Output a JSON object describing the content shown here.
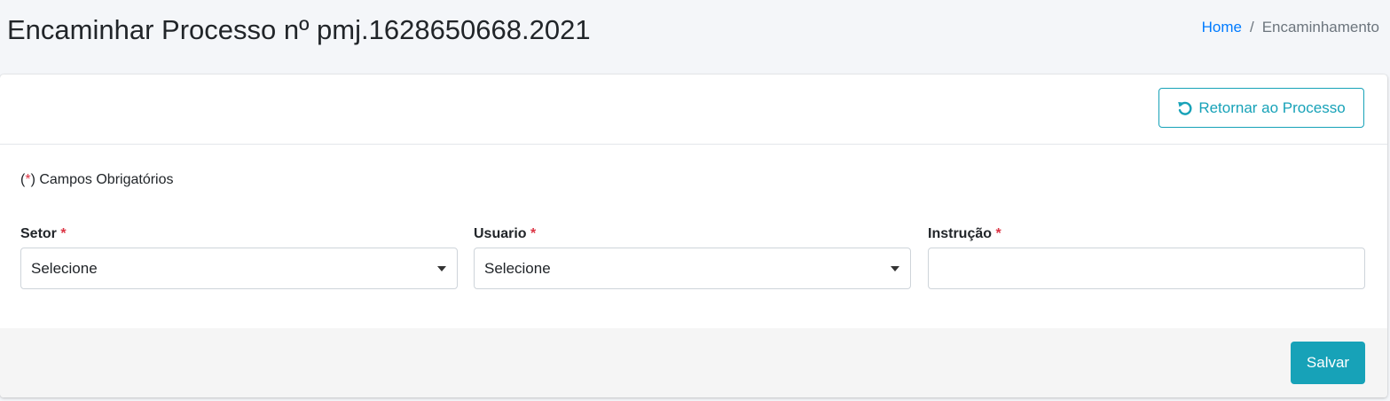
{
  "header": {
    "title": "Encaminhar Processo nº pmj.1628650668.2021",
    "breadcrumb": {
      "home": "Home",
      "separator": "/",
      "current": "Encaminhamento"
    }
  },
  "card": {
    "return_button_label": "Retornar ao Processo",
    "return_button_icon": "undo-icon",
    "required_note": {
      "open": "(",
      "star": "*",
      "close": ") Campos Obrigatórios"
    },
    "fields": {
      "setor": {
        "label": "Setor",
        "required_mark": "*",
        "value": "Selecione"
      },
      "usuario": {
        "label": "Usuario",
        "required_mark": "*",
        "value": "Selecione"
      },
      "instrucao": {
        "label": "Instrução",
        "required_mark": "*",
        "value": ""
      }
    },
    "save_button_label": "Salvar"
  },
  "colors": {
    "accent": "#17a2b8",
    "link": "#007bff",
    "required": "#dc3545",
    "background": "#f4f6f9"
  }
}
